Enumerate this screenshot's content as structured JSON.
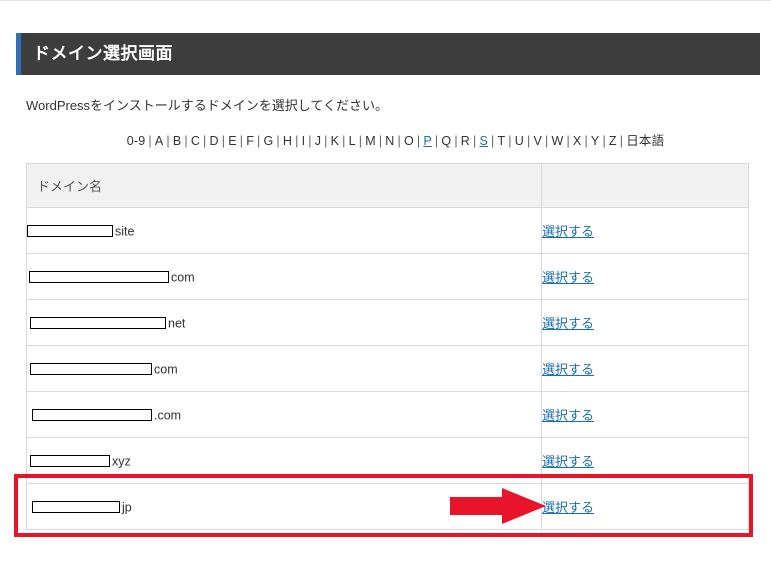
{
  "header": {
    "title": "ドメイン選択画面"
  },
  "intro_text": "WordPressをインストールするドメインを選択してください。",
  "alphabet_nav": {
    "items": [
      "0-9",
      "A",
      "B",
      "C",
      "D",
      "E",
      "F",
      "G",
      "H",
      "I",
      "J",
      "K",
      "L",
      "M",
      "N",
      "O",
      "P",
      "Q",
      "R",
      "S",
      "T",
      "U",
      "V",
      "W",
      "X",
      "Y",
      "Z",
      "日本語"
    ],
    "links": [
      "P",
      "S"
    ]
  },
  "table": {
    "headers": [
      "ドメイン名",
      ""
    ],
    "rows": [
      {
        "tld": "site",
        "action": "選択する"
      },
      {
        "tld": "com",
        "action": "選択する"
      },
      {
        "tld": "net",
        "action": "選択する"
      },
      {
        "tld": "com",
        "action": "選択する"
      },
      {
        "tld": ".com",
        "action": "選択する"
      },
      {
        "tld": "xyz",
        "action": "選択する"
      },
      {
        "tld": "jp",
        "action": "選択する"
      }
    ]
  },
  "annotation": {
    "highlight_color": "#e8142a",
    "arrow_color": "#e8142a"
  }
}
